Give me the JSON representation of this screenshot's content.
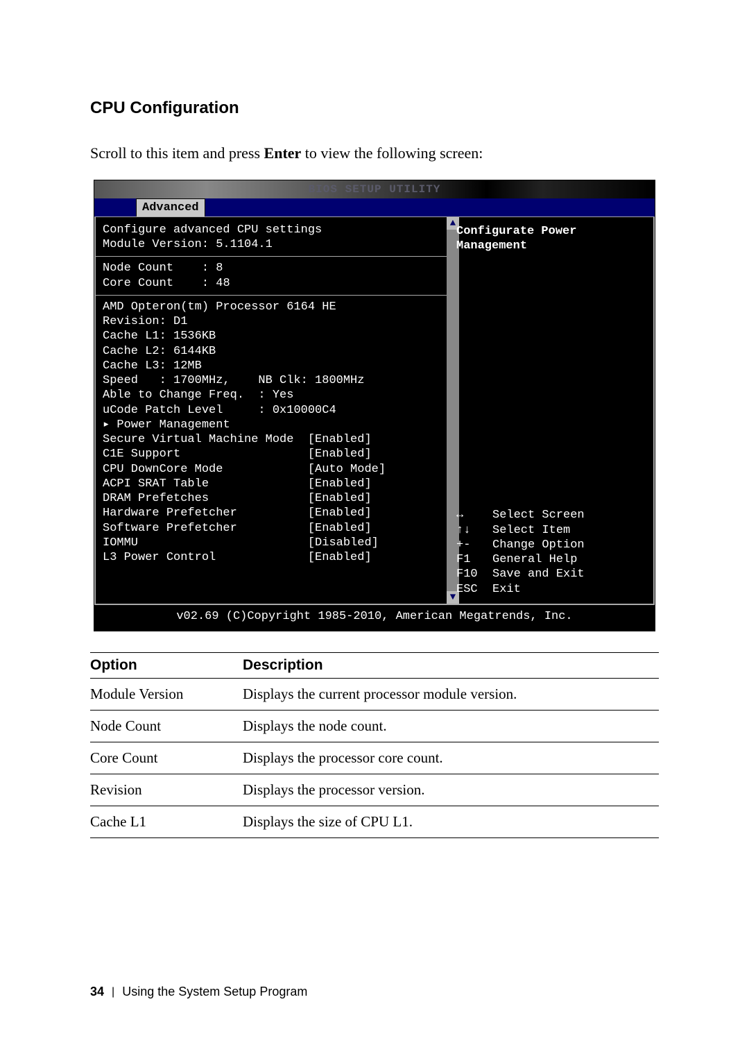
{
  "section_title": "CPU Configuration",
  "intro_prefix": "Scroll to this item and press ",
  "intro_bold": "Enter",
  "intro_suffix": " to view the following screen:",
  "bios": {
    "title_bar": "BIOS SETUP UTILITY",
    "tab": "Advanced",
    "header1": "Configure advanced CPU settings",
    "header2": "Module Version: 5.1104.1",
    "counts": {
      "node_label": "Node Count",
      "node_value": ": 8",
      "core_label": "Core Count",
      "core_value": ": 48"
    },
    "cpu_info": [
      "AMD Opteron(tm) Processor 6164 HE",
      "Revision: D1",
      "Cache L1: 1536KB",
      "Cache L2: 6144KB",
      "Cache L3: 12MB",
      "Speed   : 1700MHz,    NB Clk: 1800MHz",
      "Able to Change Freq.  : Yes",
      "uCode Patch Level     : 0x10000C4"
    ],
    "pm_item": "▸ Power Management",
    "settings": [
      {
        "label": "Secure Virtual Machine Mode",
        "value": "[Enabled]"
      },
      {
        "label": "C1E Support",
        "value": "[Enabled]"
      },
      {
        "label": "CPU DownCore Mode",
        "value": "[Auto Mode]"
      },
      {
        "label": "ACPI SRAT Table",
        "value": "[Enabled]"
      },
      {
        "label": "DRAM Prefetches",
        "value": "[Enabled]"
      },
      {
        "label": "Hardware Prefetcher",
        "value": "[Enabled]"
      },
      {
        "label": "Software Prefetcher",
        "value": "[Enabled]"
      },
      {
        "label": "IOMMU",
        "value": "[Disabled]"
      },
      {
        "label": "L3 Power Control",
        "value": "[Enabled]"
      }
    ],
    "help_title": "Configurate Power Management",
    "legend": [
      {
        "key": "↔",
        "desc": "Select Screen"
      },
      {
        "key": "↑↓",
        "desc": "Select Item"
      },
      {
        "key": "+-",
        "desc": "Change Option"
      },
      {
        "key": "F1",
        "desc": "General Help"
      },
      {
        "key": "F10",
        "desc": "Save and Exit"
      },
      {
        "key": "ESC",
        "desc": "Exit"
      }
    ],
    "footer": "v02.69 (C)Copyright 1985-2010, American Megatrends, Inc."
  },
  "table": {
    "head_option": "Option",
    "head_desc": "Description",
    "rows": [
      {
        "option": "Module Version",
        "desc": "Displays the current processor module version."
      },
      {
        "option": "Node Count",
        "desc": "Displays the node count."
      },
      {
        "option": "Core Count",
        "desc": "Displays the processor core count."
      },
      {
        "option": "Revision",
        "desc": "Displays the processor version."
      },
      {
        "option": "Cache L1",
        "desc": "Displays the size of CPU L1."
      }
    ]
  },
  "page_footer": {
    "number": "34",
    "text": "Using the System Setup Program"
  }
}
